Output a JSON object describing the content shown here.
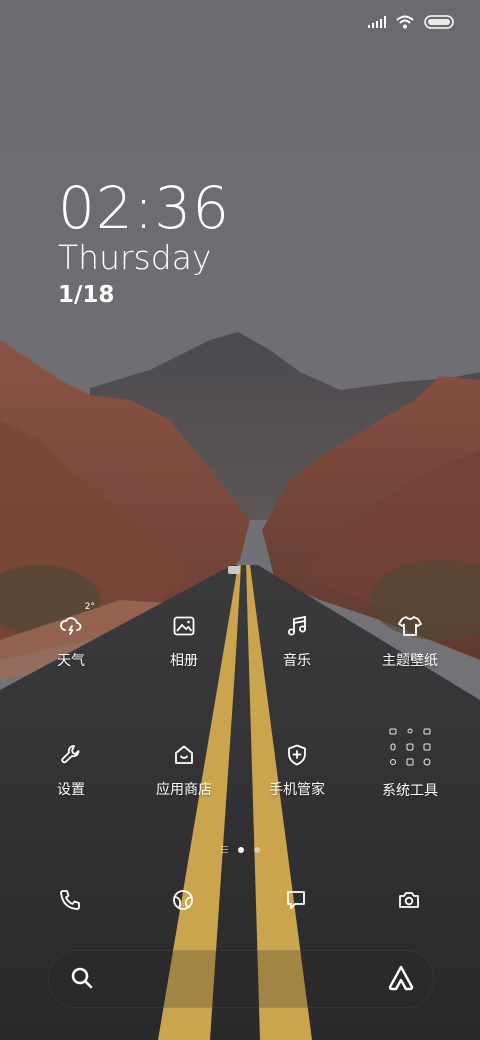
{
  "clock": {
    "time": "02:36",
    "day": "Thursday",
    "date": "1/18"
  },
  "status_bar": {
    "icons": [
      "signal-icon",
      "wifi-icon",
      "battery-icon"
    ]
  },
  "apps": [
    {
      "label": "天气",
      "icon": "weather-icon",
      "badge": "2°"
    },
    {
      "label": "相册",
      "icon": "gallery-icon"
    },
    {
      "label": "音乐",
      "icon": "music-icon"
    },
    {
      "label": "主题壁纸",
      "icon": "theme-icon"
    },
    {
      "label": "设置",
      "icon": "settings-icon"
    },
    {
      "label": "应用商店",
      "icon": "app-store-icon"
    },
    {
      "label": "手机管家",
      "icon": "security-icon"
    },
    {
      "label": "系统工具",
      "icon": "folder-icon"
    }
  ],
  "pager": {
    "pages": 2,
    "active": 0
  },
  "dock": [
    {
      "icon": "phone-icon"
    },
    {
      "icon": "browser-icon"
    },
    {
      "icon": "messages-icon"
    },
    {
      "icon": "camera-icon"
    }
  ],
  "search": {
    "left_icon": "search-icon",
    "right_icon": "assistant-icon"
  }
}
